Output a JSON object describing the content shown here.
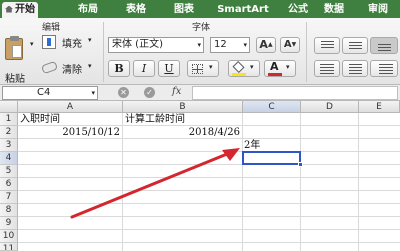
{
  "tabs": [
    "开始",
    "布局",
    "表格",
    "图表",
    "SmartArt",
    "公式",
    "数据",
    "审阅"
  ],
  "ribbon": {
    "edit_group": "编辑",
    "font_group": "字体",
    "paste_label": "粘贴",
    "fill_label": "填充",
    "clear_label": "清除",
    "font_name": "宋体 (正文)",
    "font_size": "12",
    "bold": "B",
    "italic": "I",
    "underline": "U",
    "grow_font": "A",
    "shrink_font": "A",
    "font_color_letter": "A"
  },
  "formula_bar": {
    "name_box": "C4",
    "fx_label": "fx",
    "formula": ""
  },
  "sheet": {
    "columns": [
      "A",
      "B",
      "C",
      "D",
      "E"
    ],
    "rows": [
      "1",
      "2",
      "3",
      "4",
      "5",
      "6",
      "7",
      "8",
      "9",
      "10",
      "11"
    ],
    "cells": {
      "A1": "入职时间",
      "B1": "计算工龄时间",
      "A2": "2015/10/12",
      "B2": "2018/4/26",
      "C3": "2年"
    },
    "active_cell": "C4"
  },
  "colors": {
    "tab_bar": "#3f7f3f",
    "selection": "#2f56c7",
    "arrow": "#d4262e",
    "fill_highlight": "#f7e323",
    "font_color_bar": "#d4262e"
  }
}
